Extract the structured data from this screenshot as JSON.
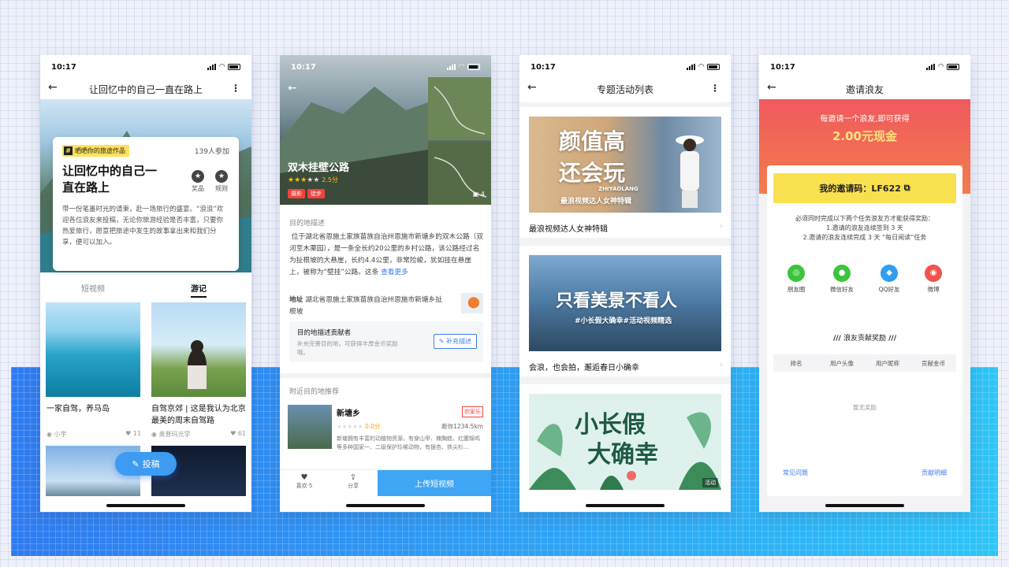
{
  "status_time": "10:17",
  "phone1": {
    "nav_title": "让回忆中的自己一直在路上",
    "tag": "晒晒你的旅途作品",
    "participants": "139人参加",
    "card_title": "让回忆中的自己一直在路上",
    "action_prize": "奖品",
    "action_rules": "规则",
    "body": "带一份笔墨时光的请柬，赴一场旅行的盛宴。“浪浪”欢迎各位浪友来投稿，无论你旅游经验是否丰富，只要你热爱旅行，愿意把旅途中发生的故事拿出来和我们分享，便可以加入。",
    "tabs": [
      "短视频",
      "游记"
    ],
    "items": [
      {
        "text": "一家自驾，养马岛",
        "user": "小宇",
        "likes": "11"
      },
      {
        "text": "自驾京郊 | 这是我认为北京最美的周末自驾路",
        "user": "奥普玛光学",
        "likes": "61"
      }
    ],
    "fab": "投稿"
  },
  "phone2": {
    "title": "双木挂壁公路",
    "score": "2.5分",
    "chips": [
      "摄影",
      "徒步"
    ],
    "photo_count": "4",
    "desc_head": "目的地描述",
    "desc": "位于湖北省恩施土家族苗族自治州恩施市新塘乡的双木公路（双河至木栗园），是一条全长约20公里的乡村公路，该公路经过名为扯根坡的大悬崖，长约4.4公里，非常险峻，犹如挂在悬崖上，被称为“壁挂”公路。这条",
    "more": "查看更多",
    "addr_label": "地址",
    "addr": "湖北省恩施土家族苗族自治州恩施市新塘乡扯根坡",
    "contrib_title": "目的地描述贡献者",
    "contrib_sub": "补充完善目的地，可获得丰厚金币奖励哦。",
    "contrib_btn": "补充描述",
    "nearby_head": "附近目的地推荐",
    "nearby_name": "新塘乡",
    "nearby_badge": "农家乐",
    "nearby_score": "0.0分",
    "nearby_dist": "距你1234.5km",
    "nearby_desc": "新塘拥有丰富的动植物资源，有穿山甲、辣胸蛙、红腹锦鸡等多种国家一、二级保护珍稀动物，有银杏、铁尖杉...",
    "like": "喜欢·5",
    "share": "分享",
    "upload": "上传短视频"
  },
  "phone3": {
    "nav_title": "专题活动列表",
    "topics": [
      {
        "cap": "最浪视频达人女神特辑",
        "big1": "颜值高",
        "big2": "还会玩",
        "sub": "ZHIYAOLANG",
        "sub2": "最浪视频达人女神特辑"
      },
      {
        "cap": "会浪，也会拍，邂逅春日小确幸",
        "big1": "只看美景不看人",
        "sub2": "#小长假大确幸#活动视频精选"
      },
      {
        "big1": "小长假",
        "big2": "大确幸",
        "badge": "活动"
      }
    ]
  },
  "phone4": {
    "nav_title": "邀请浪友",
    "banner_a": "每邀请一个浪友,即可获得",
    "banner_b": "2.00元现金",
    "code": "我的邀请码：LF622",
    "rules": [
      "必须同时完成以下两个任务浪友方才能获得奖励：",
      "1.邀请的浪友连续签到 3 天",
      "2.邀请的浪友连续完成 3 天 “每日阅读”任务"
    ],
    "shares": [
      {
        "label": "朋友圈",
        "color": "#3cc43c",
        "icon": "moments-icon"
      },
      {
        "label": "微信好友",
        "color": "#3cc43c",
        "icon": "wechat-icon"
      },
      {
        "label": "QQ好友",
        "color": "#2f9df2",
        "icon": "qq-icon"
      },
      {
        "label": "微博",
        "color": "#f0524e",
        "icon": "weibo-icon"
      }
    ],
    "reward_title": "浪友贡献奖励",
    "table_headers": [
      "排名",
      "用户头像",
      "用户昵称",
      "贡献金币"
    ],
    "empty": "暂无奖励",
    "faq": "常见问题",
    "detail": "贡献明细"
  }
}
